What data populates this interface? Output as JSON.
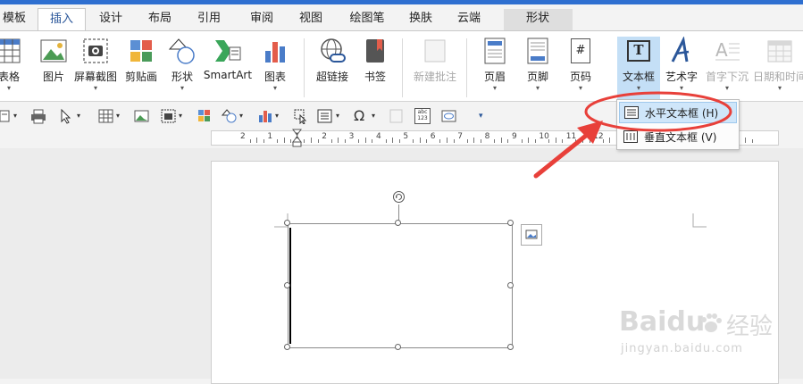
{
  "tabs": [
    {
      "label": "模板",
      "active": false
    },
    {
      "label": "插入",
      "active": true
    },
    {
      "label": "设计",
      "active": false
    },
    {
      "label": "布局",
      "active": false
    },
    {
      "label": "引用",
      "active": false
    },
    {
      "label": "审阅",
      "active": false
    },
    {
      "label": "视图",
      "active": false
    },
    {
      "label": "绘图笔",
      "active": false
    },
    {
      "label": "换肤",
      "active": false
    },
    {
      "label": "云端",
      "active": false
    },
    {
      "label": "形状",
      "active": false
    }
  ],
  "ribbon": {
    "table": "表格",
    "picture": "图片",
    "screenshot": "屏幕截图",
    "clipart": "剪贴画",
    "shapes": "形状",
    "smartart": "SmartArt",
    "chart": "图表",
    "hyperlink": "超链接",
    "bookmark": "书签",
    "new_comment": "新建批注",
    "header": "页眉",
    "footer": "页脚",
    "page_number": "页码",
    "textbox": "文本框",
    "wordart": "艺术字",
    "dropcap": "首字下沉",
    "datetime": "日期和时间",
    "textbox_glyph": "T",
    "pagenum_glyph": "#"
  },
  "quickbar": {
    "omega": "Ω",
    "abc_top": "abc",
    "abc_bottom": "123"
  },
  "ruler": {
    "labels": [
      "2",
      "1",
      "1",
      "2",
      "3",
      "4",
      "5",
      "6",
      "7",
      "8",
      "9",
      "10",
      "11",
      "12",
      "13",
      "14",
      "15",
      "16",
      "17"
    ]
  },
  "dropdown": {
    "items": [
      {
        "label": "水平文本框 (H)"
      },
      {
        "label": "垂直文本框 (V)"
      }
    ]
  },
  "watermark": {
    "brand": "Baidu",
    "brand_cn": "经验",
    "url": "jingyan.baidu.com"
  },
  "colors": {
    "accent": "#2e6fd0",
    "active_tab_text": "#2b579a",
    "highlight": "#c4dff6",
    "annotation": "#e8403a"
  }
}
